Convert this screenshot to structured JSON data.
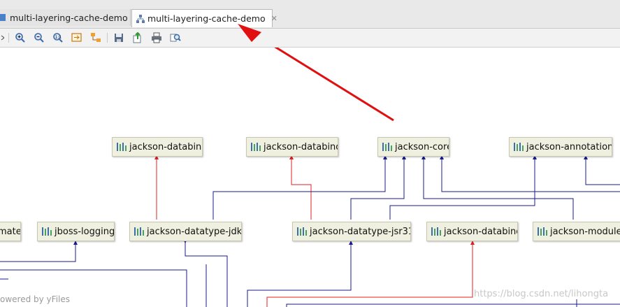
{
  "tabs": [
    {
      "label": "multi-layering-cache-demo",
      "icon": "module-icon",
      "active": false
    },
    {
      "label": "multi-layering-cache-demo",
      "icon": "diagram-icon",
      "active": true
    }
  ],
  "toolbar": {
    "buttons": [
      "zoom-in-icon",
      "zoom-out-icon",
      "actual-size-icon",
      "fit-content-icon",
      "layout-icon",
      "save-icon",
      "export-icon",
      "print-icon",
      "search-icon"
    ]
  },
  "nodes": {
    "top": [
      {
        "label": "jackson-databind"
      },
      {
        "label": "jackson-databind"
      },
      {
        "label": "jackson-core"
      },
      {
        "label": "jackson-annotations"
      }
    ],
    "middle": [
      {
        "label": "mate"
      },
      {
        "label": "jboss-logging"
      },
      {
        "label": "jackson-datatype-jdk8"
      },
      {
        "label": "jackson-datatype-jsr310"
      },
      {
        "label": "jackson-databind"
      },
      {
        "label": "jackson-module-p"
      }
    ]
  },
  "footer": {
    "powered_by": "owered by yFiles",
    "blog_watermark": "https://blog.csdn.net/lihongta"
  },
  "colors": {
    "edge_normal": "#1a1a8c",
    "edge_conflict": "#e02020",
    "annotation_arrow": "#e01010",
    "node_bg": "#f0f0e0"
  }
}
